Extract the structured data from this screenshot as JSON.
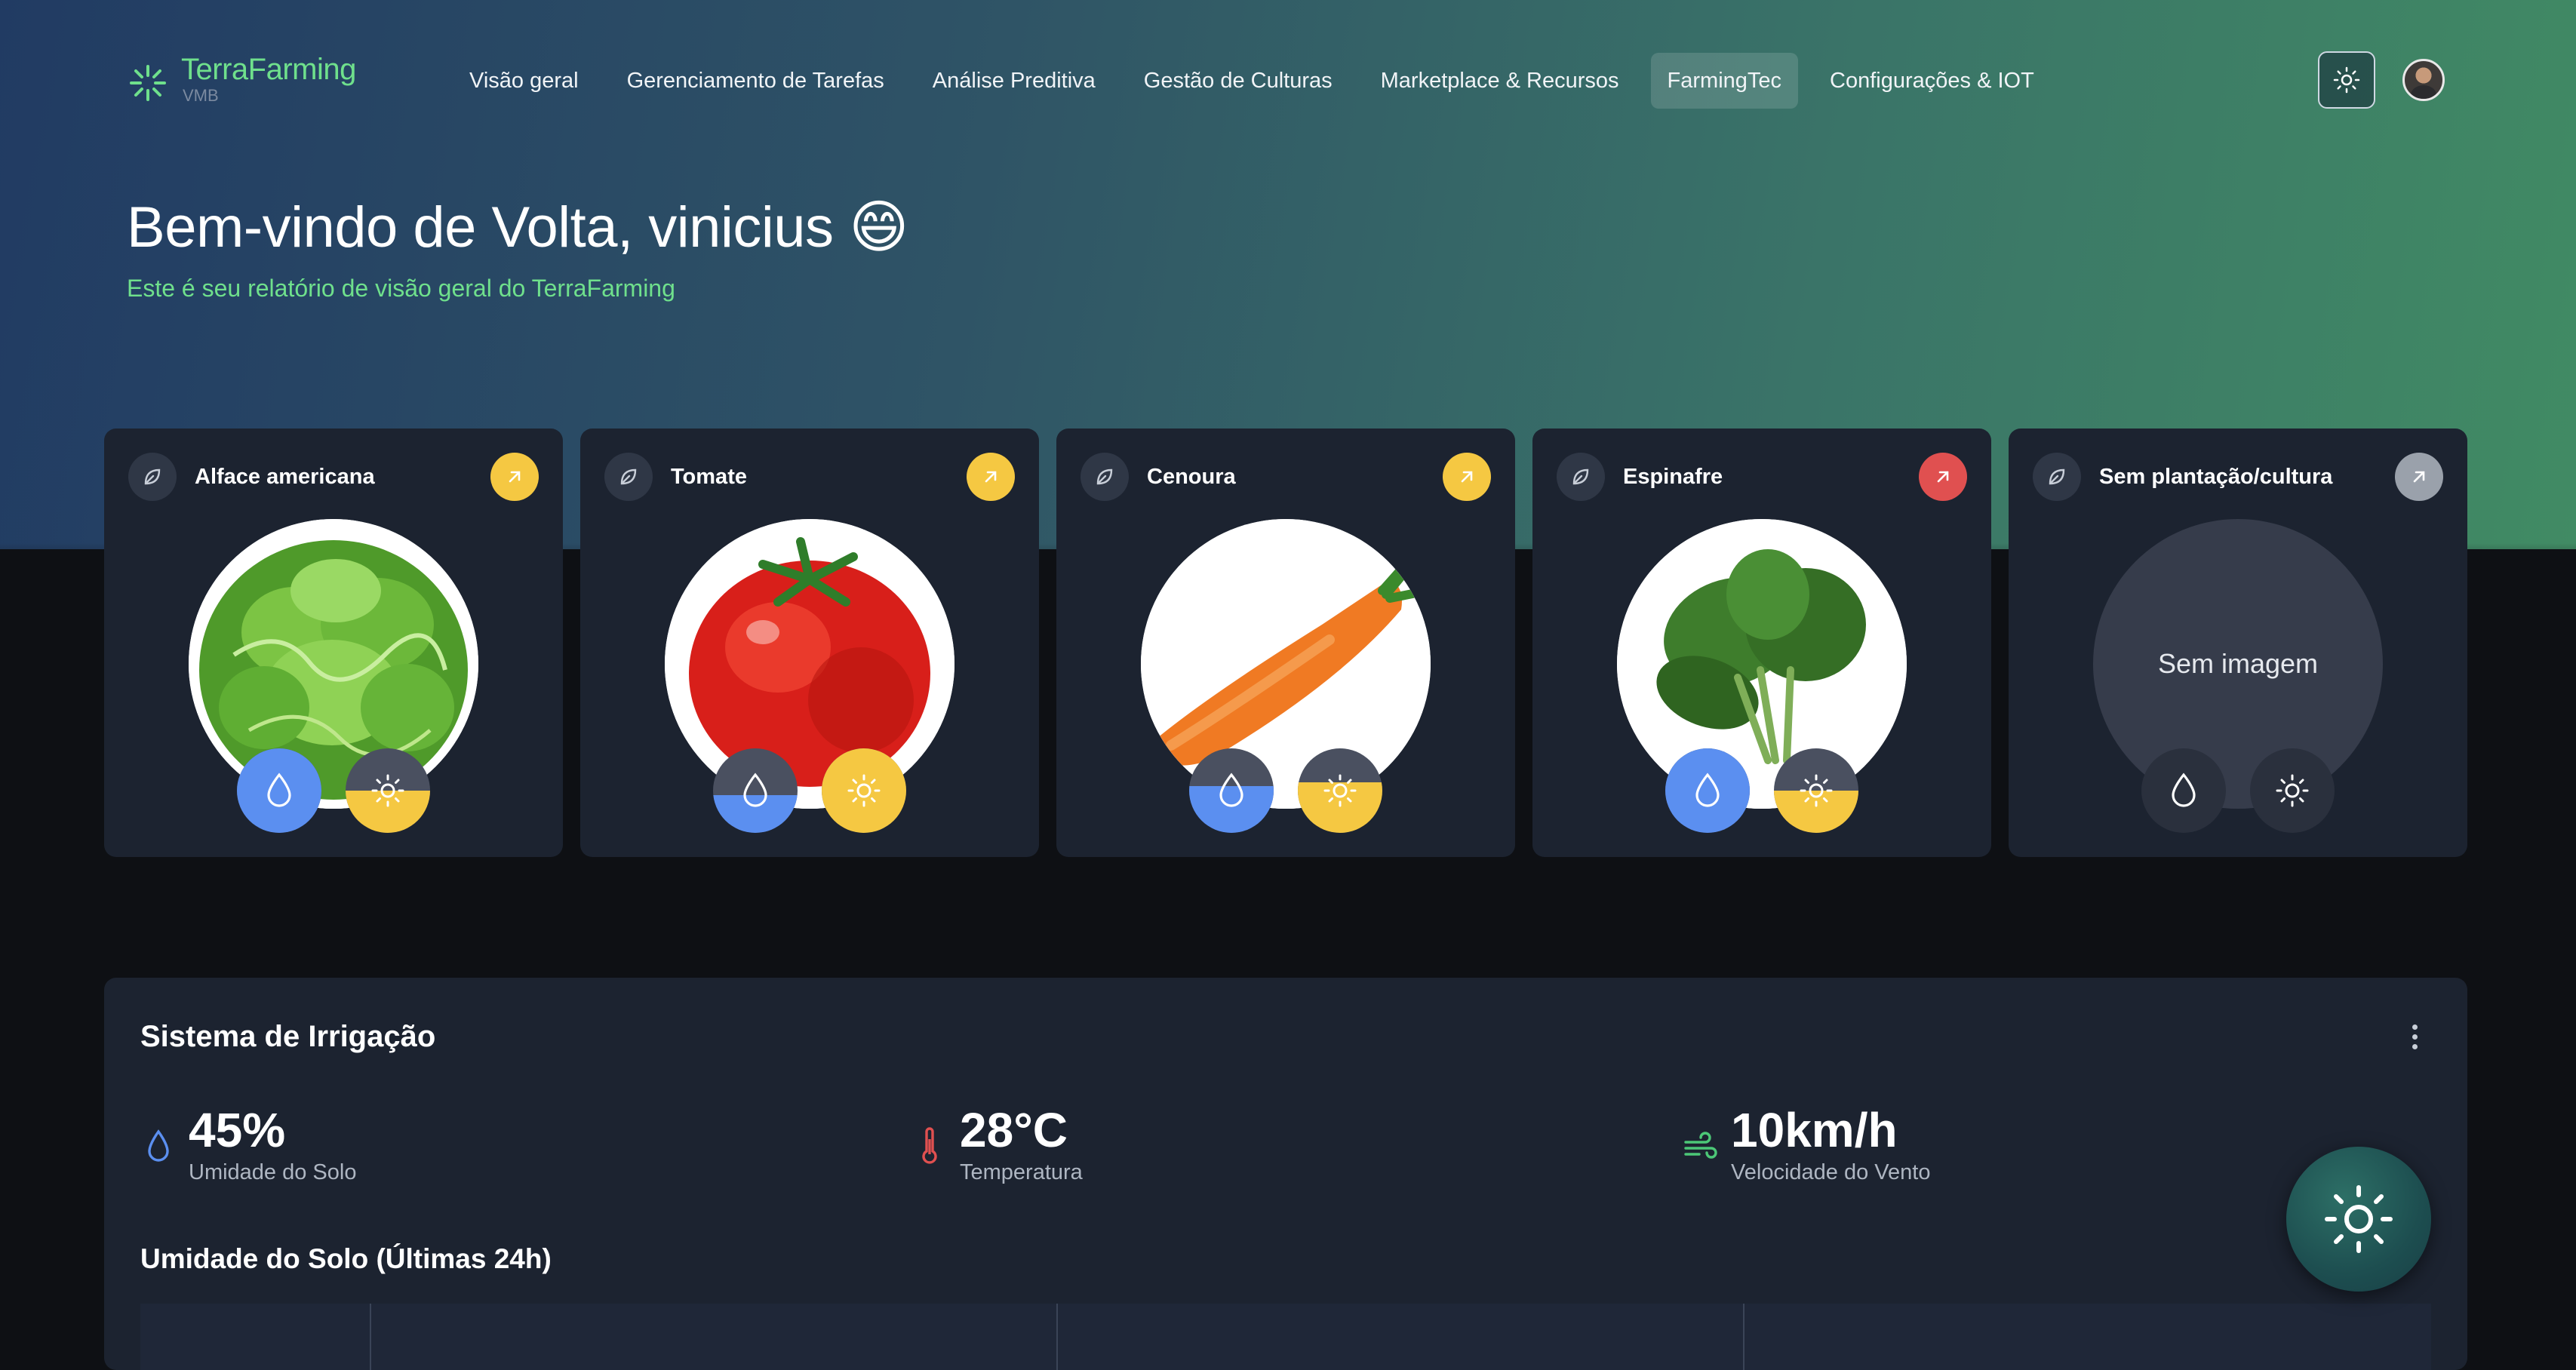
{
  "app": {
    "logo_name": "TerraFarming",
    "logo_sub": "VMB",
    "accent": "#6fe08c"
  },
  "nav": {
    "items": [
      {
        "label": "Visão geral",
        "active": false
      },
      {
        "label": "Gerenciamento de Tarefas",
        "active": false
      },
      {
        "label": "Análise Preditiva",
        "active": false
      },
      {
        "label": "Gestão de Culturas",
        "active": false
      },
      {
        "label": "Marketplace & Recursos",
        "active": false
      },
      {
        "label": "FarmingTec",
        "active": true
      },
      {
        "label": "Configurações & IOT",
        "active": false
      }
    ],
    "theme_icon": "sun-icon",
    "avatar_icon": "user-avatar"
  },
  "header": {
    "welcome": "Bem-vindo de Volta, vinicius 😄",
    "subtitle": "Este é seu relatório de visão geral do TerraFarming"
  },
  "crops": [
    {
      "name": "Alface americana",
      "status_color": "#f5c842",
      "image": "lettuce",
      "water_level": 1.0,
      "sun_level": 0.5
    },
    {
      "name": "Tomate",
      "status_color": "#f5c842",
      "image": "tomato",
      "water_level": 0.45,
      "sun_level": 1.0
    },
    {
      "name": "Cenoura",
      "status_color": "#f5c842",
      "image": "carrot",
      "water_level": 0.55,
      "sun_level": 0.6
    },
    {
      "name": "Espinafre",
      "status_color": "#e05050",
      "image": "spinach",
      "water_level": 1.0,
      "sun_level": 0.5
    },
    {
      "name": "Sem plantação/cultura",
      "status_color": "#9aa1ab",
      "image": "",
      "no_image_label": "Sem imagem",
      "water_level": 0,
      "sun_level": 0
    }
  ],
  "irrigation": {
    "title": "Sistema de Irrigação",
    "metrics": [
      {
        "value": "45%",
        "label": "Umidade do Solo",
        "icon": "droplet-icon",
        "color": "#5b8ff0"
      },
      {
        "value": "28°C",
        "label": "Temperatura",
        "icon": "thermometer-icon",
        "color": "#e05050"
      },
      {
        "value": "10km/h",
        "label": "Velocidade do Vento",
        "icon": "wind-icon",
        "color": "#4cc777"
      }
    ],
    "chart_title": "Umidade do Solo (Últimas 24h)"
  },
  "colors": {
    "water": "#5b8ff0",
    "sun": "#f5c842",
    "empty_stat": "#4a5060"
  }
}
